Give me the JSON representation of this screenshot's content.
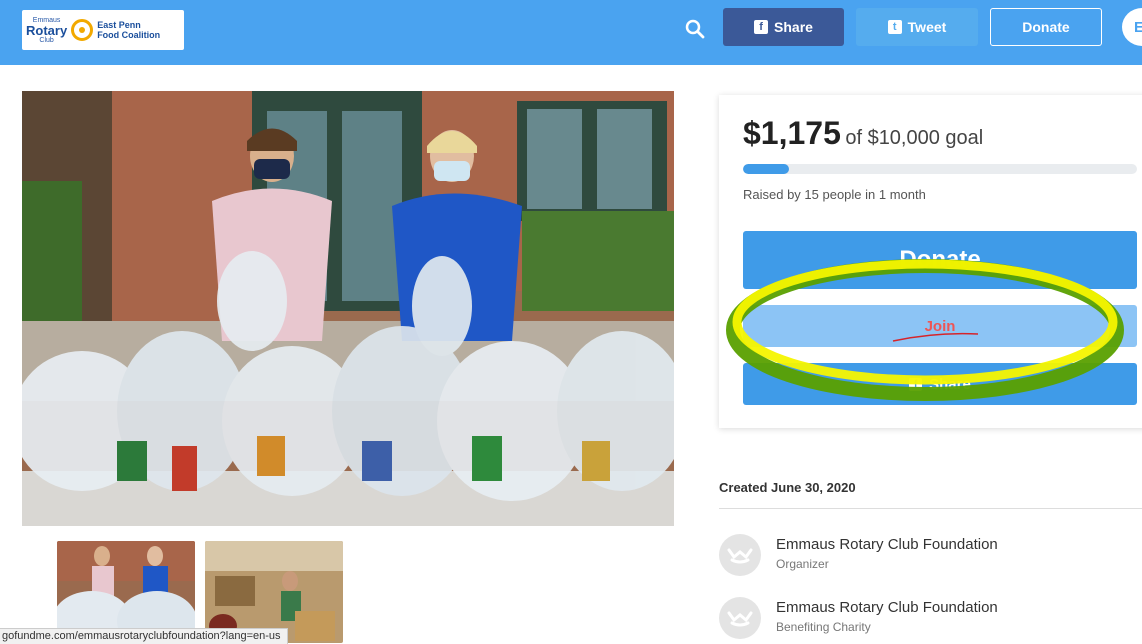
{
  "header": {
    "logo": {
      "small_top": "Emmaus",
      "rotary": "Rotary",
      "small_bottom": "Club",
      "partner_line1": "East Penn",
      "partner_line2": "Food Coalition"
    },
    "share_label": "Share",
    "tweet_label": "Tweet",
    "donate_label": "Donate",
    "avatar_letter": "E",
    "colors": {
      "bar": "#4aa3f0",
      "facebook": "#3b5998",
      "twitter": "#55acee"
    }
  },
  "gallery": {
    "main_icon": "photo-food-bags",
    "thumbnails": [
      "thumb-volunteers",
      "thumb-warehouse"
    ]
  },
  "status_bar": {
    "url": "gofundme.com/emmausrotaryclubfoundation?lang=en-us"
  },
  "campaign": {
    "amount_raised": "$1,175",
    "goal_text": "of $10,000 goal",
    "progress_fraction": 0.1175,
    "raised_by": "Raised by 15 people in 1 month",
    "donate_label": "Donate",
    "join_label": "Join",
    "share_label": "Share",
    "colors": {
      "primary": "#3f9be8",
      "join": "#8cc4f5",
      "annotation_yellow": "#f5f500",
      "annotation_green": "#5aa000"
    }
  },
  "meta": {
    "created": "Created June 30, 2020",
    "people": [
      {
        "name": "Emmaus Rotary Club Foundation",
        "role": "Organizer"
      },
      {
        "name": "Emmaus Rotary Club Foundation",
        "role": "Benefiting Charity"
      }
    ]
  }
}
